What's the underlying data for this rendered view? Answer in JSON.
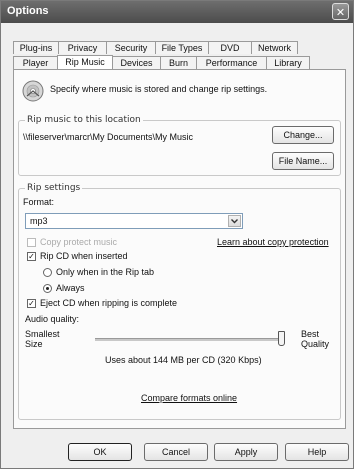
{
  "window": {
    "title": "Options",
    "close_glyph": "✕"
  },
  "tabs_row1": [
    "Plug-ins",
    "Privacy",
    "Security",
    "File Types",
    "DVD",
    "Network"
  ],
  "tabs_row2": [
    "Player",
    "Rip Music",
    "Devices",
    "Burn",
    "Performance",
    "Library"
  ],
  "active_tab": "Rip Music",
  "header": {
    "icon": "cd-rip-icon",
    "description": "Specify where music is stored and change rip settings."
  },
  "location": {
    "legend": "Rip music to this location",
    "path": "\\\\fileserver\\marcr\\My Documents\\My Music",
    "change_label": "Change...",
    "filename_label": "File Name..."
  },
  "rip_settings": {
    "legend": "Rip settings",
    "format_label": "Format:",
    "format_value": "mp3",
    "copy_protect_label": "Copy protect music",
    "copy_protect_checked": false,
    "copy_protect_link": "Learn about copy protection",
    "rip_when_inserted_label": "Rip CD when inserted",
    "rip_when_inserted_checked": true,
    "only_rip_tab_label": "Only when in the Rip tab",
    "always_label": "Always",
    "radio_selected": "Always",
    "eject_label": "Eject CD when ripping is complete",
    "eject_checked": true,
    "audio_quality_label": "Audio quality:",
    "smallest_label_1": "Smallest",
    "smallest_label_2": "Size",
    "best_label_1": "Best",
    "best_label_2": "Quality",
    "slider_level": 1.0,
    "usage_text": "Uses about 144 MB per CD (320 Kbps)",
    "compare_link": "Compare formats online"
  },
  "buttons": {
    "ok": "OK",
    "cancel": "Cancel",
    "apply": "Apply",
    "help": "Help"
  },
  "check_glyph": "✓"
}
